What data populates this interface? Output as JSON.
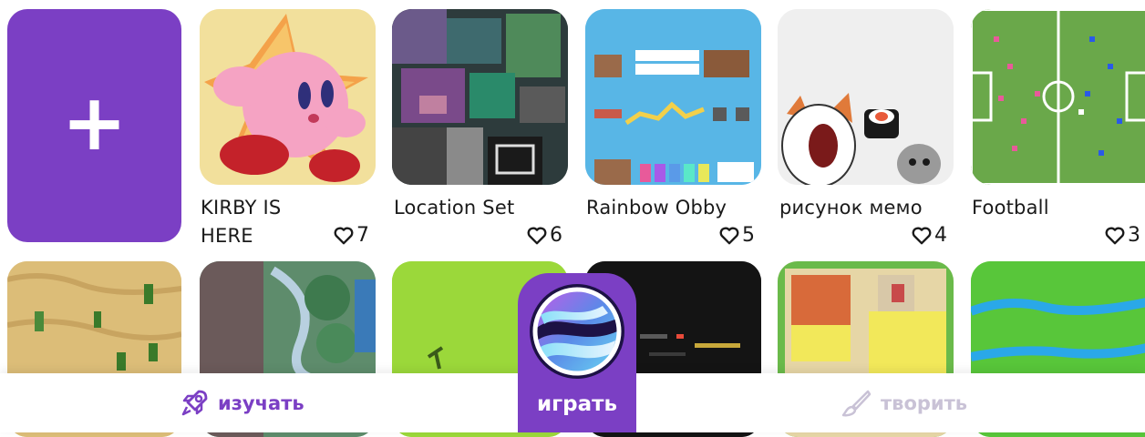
{
  "grid": {
    "add_label": "+",
    "cards": [
      {
        "title": "KIRBY IS HERE",
        "title_line1": "KIRBY IS",
        "title_line2": "HERE",
        "likes": "7"
      },
      {
        "title": "Location Set",
        "likes": "6"
      },
      {
        "title": "Rainbow Obby",
        "likes": "5"
      },
      {
        "title": "рисунок мемо",
        "likes": "4"
      },
      {
        "title": "Football",
        "likes": "3"
      }
    ]
  },
  "nav": {
    "learn_label": "изучать",
    "play_label": "играть",
    "create_label": "творить"
  },
  "colors": {
    "accent": "#7b3fc4",
    "inactive": "#c9c2d6",
    "text": "#1a1a1a"
  },
  "icons": {
    "like": "heart-outline-icon",
    "learn": "rocket-icon",
    "create": "brush-icon",
    "play": "planet-swirl-logo-icon"
  }
}
